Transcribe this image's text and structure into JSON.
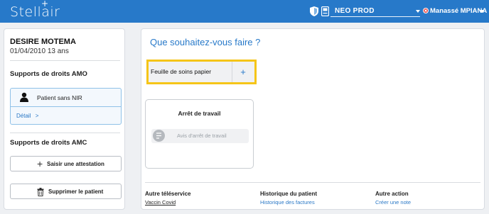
{
  "app": {
    "logo": "Stellair",
    "logo_plus": "+"
  },
  "header": {
    "environment": "NEO PROD",
    "user": "Manassé MPIANA",
    "icons": [
      "shield-icon",
      "card-reader-icon"
    ],
    "brand_color": "#2779c9"
  },
  "patient": {
    "name": "DESIRE MOTEMA",
    "dob_age": "01/04/2010 13 ans"
  },
  "amo": {
    "title": "Supports de droits AMO",
    "card_label": "Patient sans NIR",
    "detail_link": "Détail",
    "detail_chevron": ">"
  },
  "amc": {
    "title": "Supports de droits AMC",
    "add_attestation": "Saisir une attestation",
    "add_symbol": "+"
  },
  "delete_patient": "Supprimer le patient",
  "main": {
    "question": "Que souhaitez-vous faire ?",
    "fsp_label": "Feuille de soins papier",
    "fsp_add": "+",
    "arret_title": "Arrêt de travail",
    "arret_button": "Avis d'arrêt de travail",
    "highlight_color": "#f5c518"
  },
  "footer": {
    "col1_title": "Autre téléservice",
    "col1_link": "Vaccin Covid",
    "col2_title": "Historique du patient",
    "col2_link": "Historique des factures",
    "col3_title": "Autre action",
    "col3_link": "Créer une note"
  }
}
